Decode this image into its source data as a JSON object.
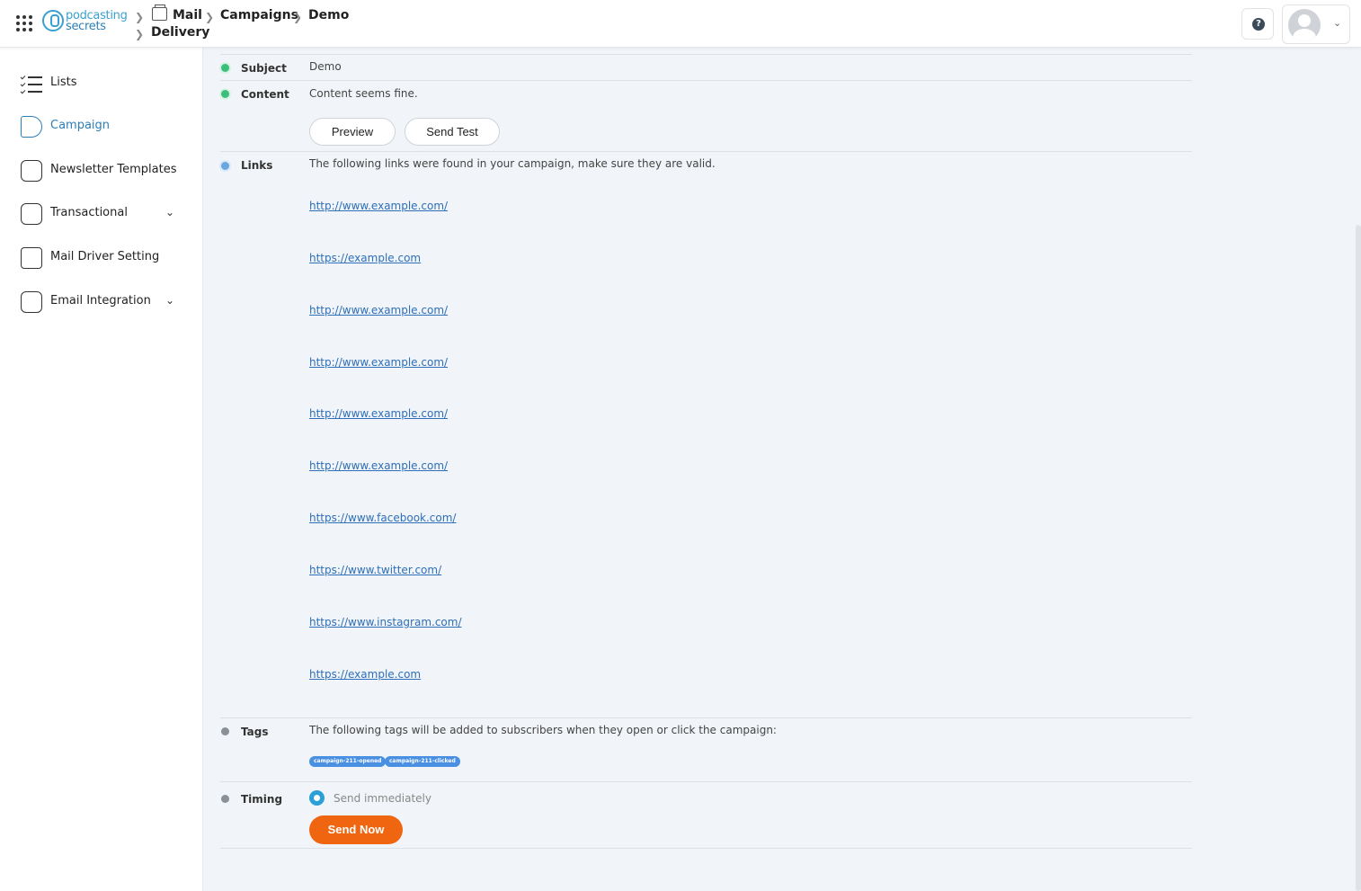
{
  "header": {
    "logo_line1": "podcasting",
    "logo_line2": "secrets",
    "breadcrumb": [
      "Mail Delivery",
      "Campaigns",
      "Demo"
    ],
    "breadcrumb_mail": "Mail",
    "breadcrumb_delivery": "Delivery",
    "help_label": "?"
  },
  "sidebar": {
    "items": [
      {
        "label": "Lists",
        "icon": "checklist-icon"
      },
      {
        "label": "Campaign",
        "icon": "megaphone-icon",
        "active": true
      },
      {
        "label": "Newsletter Templates",
        "icon": "template-icon"
      },
      {
        "label": "Transactional",
        "icon": "inbox-icon",
        "expandable": true
      },
      {
        "label": "Mail Driver Setting",
        "icon": "mail-driver-icon"
      },
      {
        "label": "Email Integration",
        "icon": "integration-icon",
        "expandable": true
      }
    ]
  },
  "review": {
    "subject": {
      "label": "Subject",
      "value": "Demo",
      "status": "ok"
    },
    "content": {
      "label": "Content",
      "value": "Content seems fine.",
      "status": "ok",
      "preview_label": "Preview",
      "send_test_label": "Send Test"
    },
    "links": {
      "label": "Links",
      "description": "The following links were found in your campaign, make sure they are valid.",
      "items": [
        "http://www.example.com/",
        "https://example.com",
        "http://www.example.com/",
        "http://www.example.com/",
        "http://www.example.com/",
        "http://www.example.com/",
        "https://www.facebook.com/",
        "https://www.twitter.com/",
        "https://www.instagram.com/",
        "https://example.com"
      ]
    },
    "tags": {
      "label": "Tags",
      "description": "The following tags will be added to subscribers when they open or click the campaign:",
      "items": [
        "campaign-211-opened",
        "campaign-211-clicked"
      ]
    },
    "timing": {
      "label": "Timing",
      "option_label": "Send immediately",
      "selected": true,
      "send_now_label": "Send Now"
    }
  },
  "colors": {
    "accent": "#2b7fb8",
    "ok": "#3bbf7a",
    "primary_button": "#f0650f",
    "tag": "#4a90e2"
  }
}
